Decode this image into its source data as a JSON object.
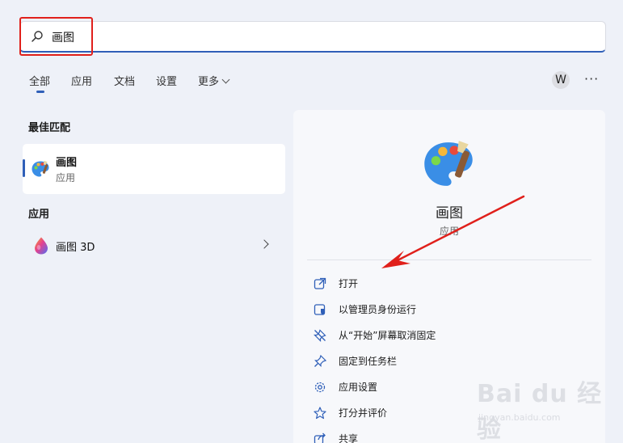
{
  "search": {
    "query": "画图"
  },
  "tabs": [
    {
      "label": "全部"
    },
    {
      "label": "应用"
    },
    {
      "label": "文档"
    },
    {
      "label": "设置"
    },
    {
      "label": "更多"
    }
  ],
  "header": {
    "avatar_letter": "W",
    "more_label": "···"
  },
  "best_match": {
    "section_title": "最佳匹配",
    "name": "画图",
    "subtitle": "应用"
  },
  "apps": {
    "section_title": "应用",
    "items": [
      {
        "name": "画图 3D"
      }
    ]
  },
  "detail": {
    "name": "画图",
    "subtitle": "应用",
    "actions": [
      {
        "label": "打开",
        "icon": "open-external-icon"
      },
      {
        "label": "以管理员身份运行",
        "icon": "shield-icon"
      },
      {
        "label": "从“开始”屏幕取消固定",
        "icon": "unpin-icon"
      },
      {
        "label": "固定到任务栏",
        "icon": "pin-icon"
      },
      {
        "label": "应用设置",
        "icon": "gear-icon"
      },
      {
        "label": "打分并评价",
        "icon": "star-icon"
      },
      {
        "label": "共享",
        "icon": "share-icon"
      }
    ]
  },
  "watermark": {
    "brand": "Bai du 经验",
    "url": "jingyan.baidu.com"
  },
  "colors": {
    "accent": "#2f5fb8",
    "annotation_red": "#e0201b"
  }
}
